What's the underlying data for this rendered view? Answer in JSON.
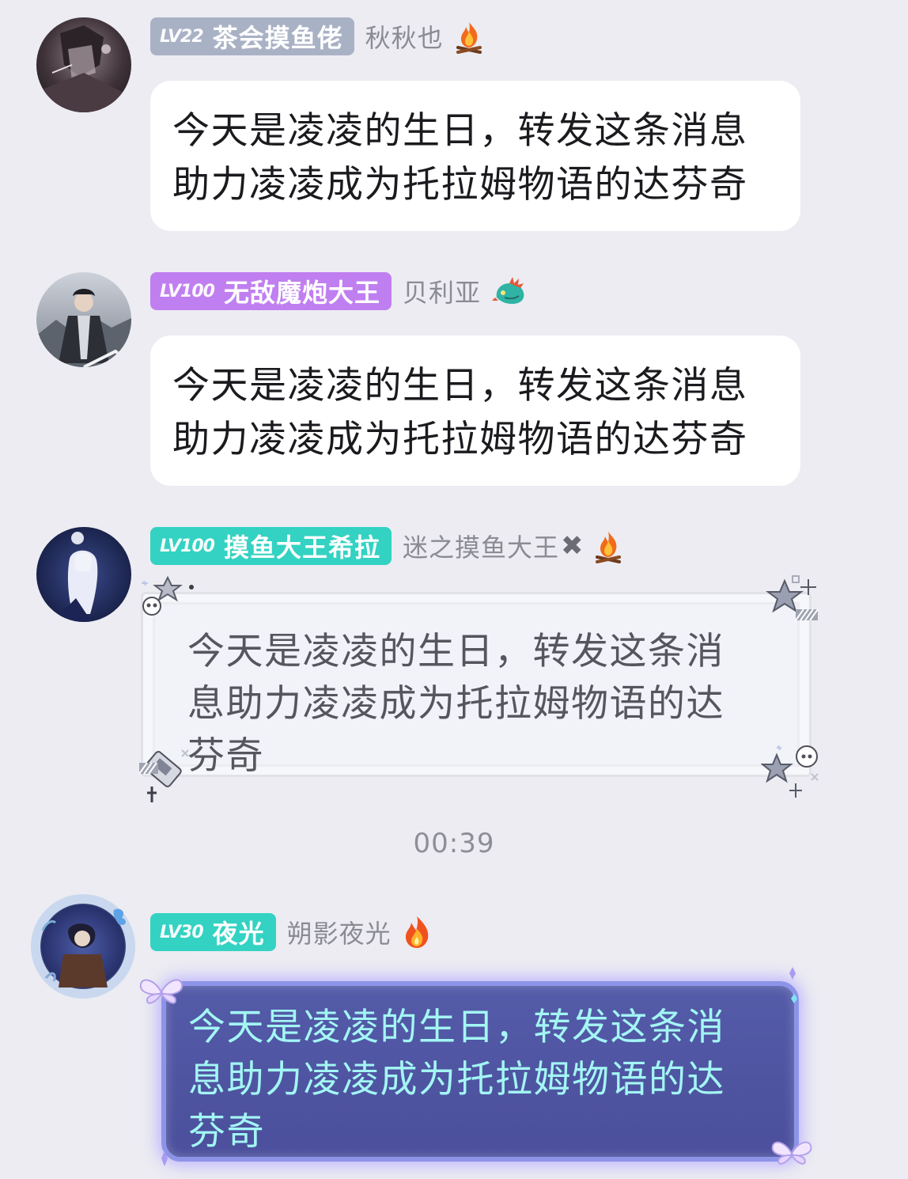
{
  "messages": [
    {
      "level": "LV22",
      "title": "茶会摸鱼佬",
      "nickname": "秋秋也",
      "badge_color": "#a9b1c5",
      "medal_icon": "campfire-icon",
      "text": "今天是凌凌的生日，转发这条消息助力凌凌成为托拉姆物语的达芬奇"
    },
    {
      "level": "LV100",
      "title": "无敌魔炮大王",
      "nickname": "贝利亚",
      "badge_color": "#c07ff0",
      "medal_icon": "dragon-icon",
      "text": "今天是凌凌的生日，转发这条消息助力凌凌成为托拉姆物语的达芬奇"
    },
    {
      "level": "LV100",
      "title": "摸鱼大王希拉",
      "nickname": "迷之摸鱼大王",
      "badge_color": "#33d2c2",
      "medal_icon": "campfire-icon",
      "text": "今天是凌凌的生日，转发这条消息助力凌凌成为托拉姆物语的达芬奇"
    },
    {
      "level": "LV30",
      "title": "夜光",
      "nickname": "朔影夜光",
      "badge_color": "#33d2c2",
      "medal_icon": "flame-icon",
      "text": "今天是凌凌的生日，转发这条消息助力凌凌成为托拉姆物语的达芬奇"
    }
  ],
  "timestamp": "00:39"
}
